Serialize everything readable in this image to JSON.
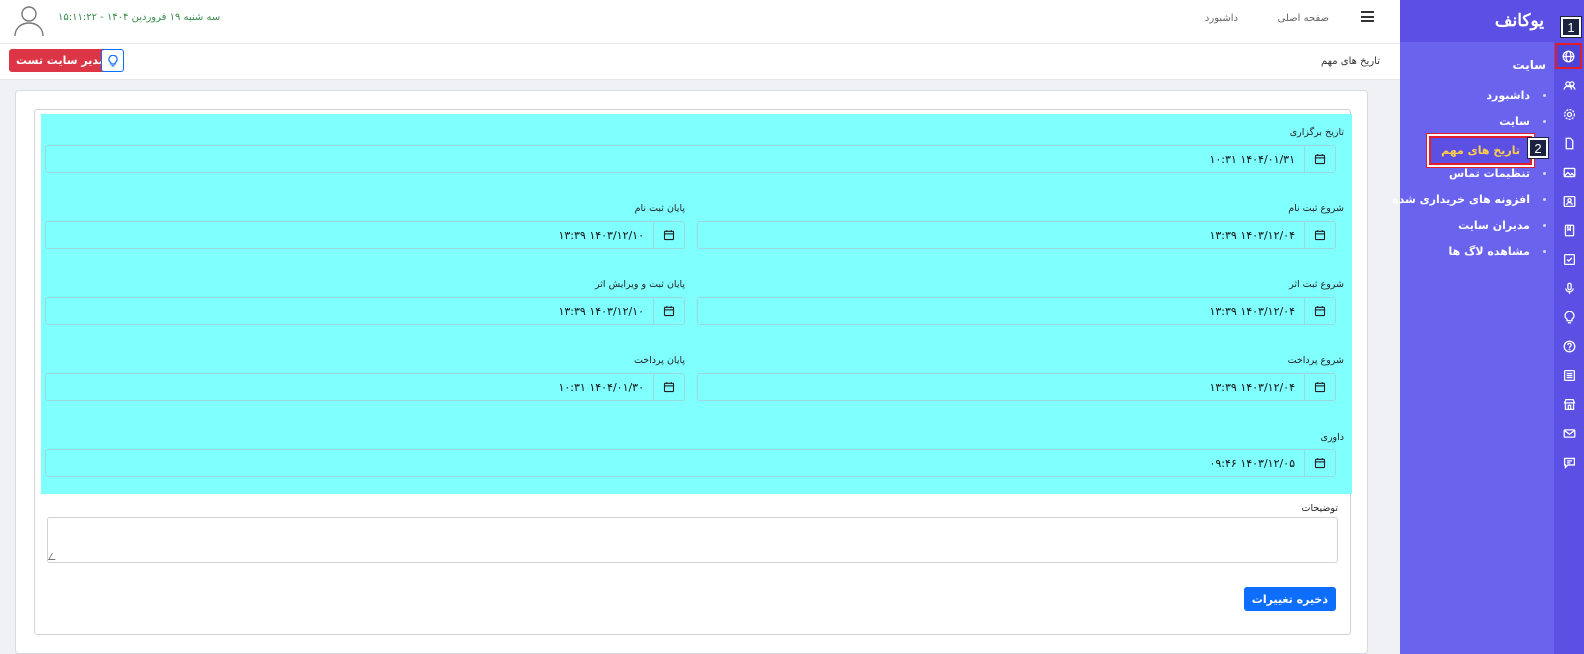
{
  "brand": {
    "logo_text": "یوکانف"
  },
  "topbar": {
    "nav_home": "صفحه اصلی",
    "nav_dashboard": "داشبورد",
    "datetime": "سه شنبه ۱۹ فروردین ۱۴۰۴ - ۱۵:۱۱:۲۲"
  },
  "subbar": {
    "page_title": "تاریخ های مهم",
    "admin_button": "مدیر سایت تست"
  },
  "sidebar": {
    "section_title": "سایت",
    "items": [
      {
        "label": "داشبورد"
      },
      {
        "label": "سایت"
      },
      {
        "label": "تاریخ های مهم"
      },
      {
        "label": "تنظیمات تماس"
      },
      {
        "label": "افزونه های خریداری شده"
      },
      {
        "label": "مدیران سایت"
      },
      {
        "label": "مشاهده لاگ ها"
      }
    ],
    "rail_icons": [
      "globe-icon",
      "users-icon",
      "gear-icon",
      "file-icon",
      "image-icon",
      "id-card-icon",
      "book-icon",
      "checkbox-icon",
      "microphone-icon",
      "lightbulb-icon",
      "question-icon",
      "list-icon",
      "store-icon",
      "mail-icon",
      "chat-icon"
    ]
  },
  "markers": {
    "one": "1",
    "two": "2"
  },
  "form": {
    "event_date": {
      "label": "تاریخ برگزاری",
      "value": "۱۰:۳۱ ۱۴۰۴/۰۱/۳۱"
    },
    "reg_start": {
      "label": "شروع ثبت نام",
      "value": "۱۳:۳۹ ۱۴۰۳/۱۲/۰۴"
    },
    "reg_end": {
      "label": "پایان ثبت نام",
      "value": "۱۳:۳۹ ۱۴۰۳/۱۲/۱۰"
    },
    "work_start": {
      "label": "شروع ثبت اثر",
      "value": "۱۳:۳۹ ۱۴۰۳/۱۲/۰۴"
    },
    "work_end": {
      "label": "پایان ثبت و ویرایش اثر",
      "value": "۱۳:۳۹ ۱۴۰۳/۱۲/۱۰"
    },
    "pay_start": {
      "label": "شروع پرداخت",
      "value": "۱۳:۳۹ ۱۴۰۳/۱۲/۰۴"
    },
    "pay_end": {
      "label": "پایان پرداخت",
      "value": "۱۰:۳۱ ۱۴۰۴/۰۱/۳۰"
    },
    "judging": {
      "label": "داوری",
      "value": "۰۹:۴۶ ۱۴۰۳/۱۲/۰۵"
    },
    "description_label": "توضیحات",
    "description_value": "",
    "save_button": "ذخیره تغییرات"
  },
  "colors": {
    "sidebar_bg": "#6a63ee",
    "rail_bg": "#5b50e3",
    "highlight_bg": "#80ffff",
    "danger": "#dc3545",
    "primary": "#0d6efd",
    "active_item_text": "#ffcf4a"
  }
}
